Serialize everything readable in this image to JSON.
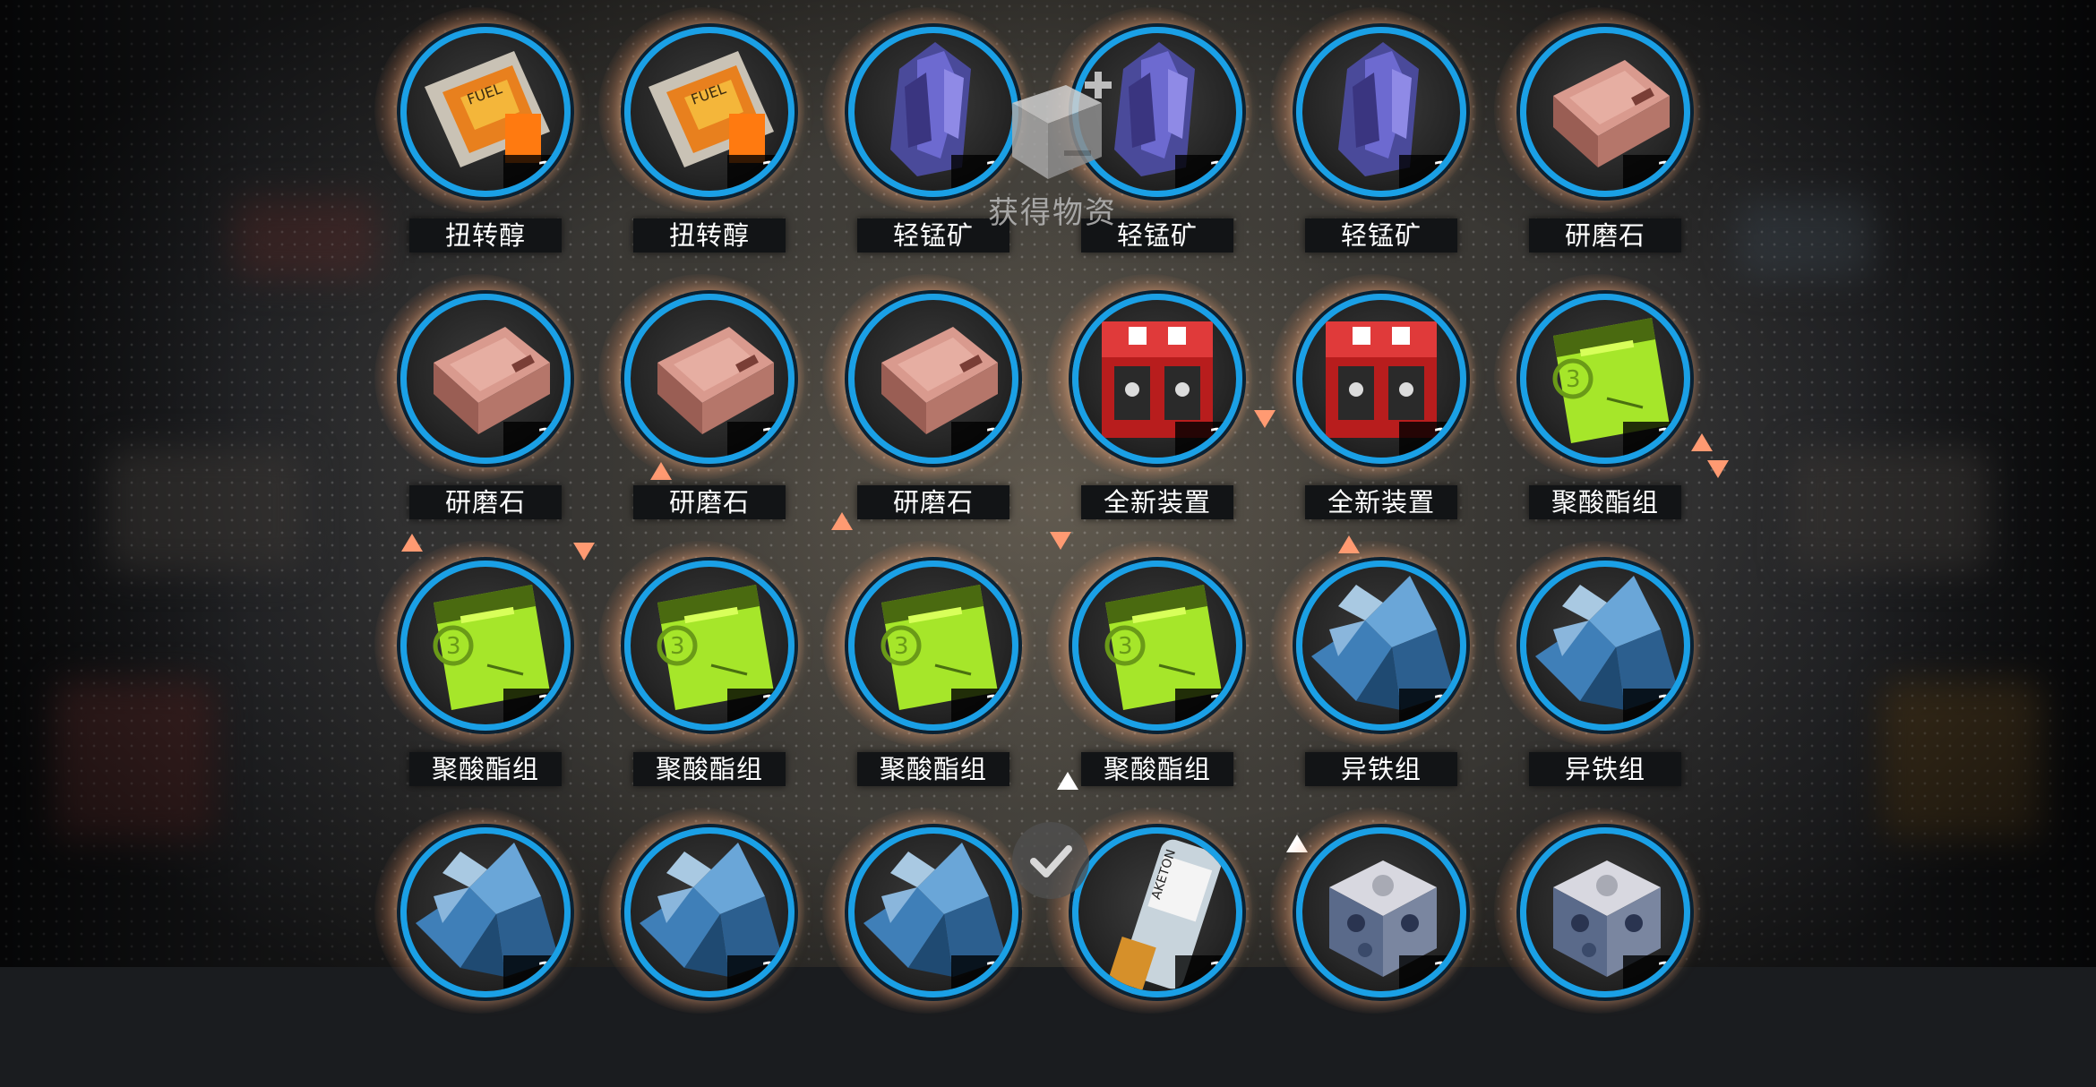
{
  "header": {
    "title": "获得物资",
    "icon": "box-plus-icon"
  },
  "confirm": {
    "icon": "check-icon"
  },
  "rows": [
    [
      {
        "name": "扭转醇",
        "count": "1",
        "icon": "fuel-pack-icon"
      },
      {
        "name": "扭转醇",
        "count": "1",
        "icon": "fuel-pack-icon"
      },
      {
        "name": "轻锰矿",
        "count": "1",
        "icon": "purple-crystal-icon"
      },
      {
        "name": "轻锰矿",
        "count": "1",
        "icon": "purple-crystal-icon"
      },
      {
        "name": "轻锰矿",
        "count": "1",
        "icon": "purple-crystal-icon"
      },
      {
        "name": "研磨石",
        "count": "1",
        "icon": "grinding-stone-icon"
      }
    ],
    [
      {
        "name": "研磨石",
        "count": "1",
        "icon": "grinding-stone-icon"
      },
      {
        "name": "研磨石",
        "count": "1",
        "icon": "grinding-stone-icon"
      },
      {
        "name": "研磨石",
        "count": "1",
        "icon": "grinding-stone-icon"
      },
      {
        "name": "全新装置",
        "count": "1",
        "icon": "red-device-icon"
      },
      {
        "name": "全新装置",
        "count": "1",
        "icon": "red-device-icon"
      },
      {
        "name": "聚酸酯组",
        "count": "1",
        "icon": "green-pack-icon"
      }
    ],
    [
      {
        "name": "聚酸酯组",
        "count": "1",
        "icon": "green-pack-icon"
      },
      {
        "name": "聚酸酯组",
        "count": "1",
        "icon": "green-pack-icon"
      },
      {
        "name": "聚酸酯组",
        "count": "1",
        "icon": "green-pack-icon"
      },
      {
        "name": "聚酸酯组",
        "count": "1",
        "icon": "green-pack-icon"
      },
      {
        "name": "异铁组",
        "count": "1",
        "icon": "blue-shard-icon"
      },
      {
        "name": "异铁组",
        "count": "1",
        "icon": "blue-shard-icon"
      }
    ],
    [
      {
        "name": "",
        "count": "1",
        "icon": "blue-shard-icon"
      },
      {
        "name": "",
        "count": "1",
        "icon": "blue-shard-icon"
      },
      {
        "name": "",
        "count": "1",
        "icon": "blue-shard-icon"
      },
      {
        "name": "",
        "count": "1",
        "icon": "ketone-bottle-icon"
      },
      {
        "name": "",
        "count": "1",
        "icon": "metal-cube-icon"
      },
      {
        "name": "",
        "count": "1",
        "icon": "metal-cube-icon"
      }
    ]
  ],
  "theme": {
    "ring": "#1aa0e6",
    "glow": "#ffc896",
    "accent": "#ff9a72"
  }
}
